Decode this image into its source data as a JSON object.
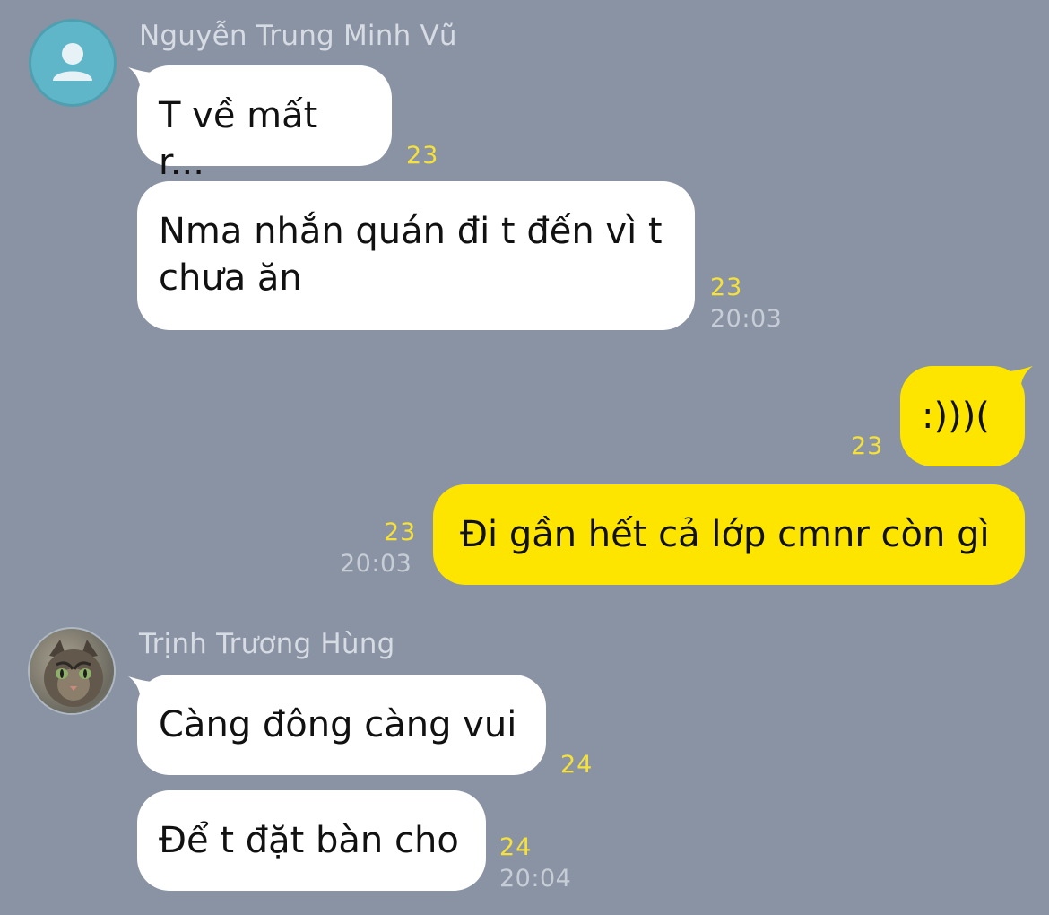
{
  "messages": [
    {
      "sender": "Nguyễn Trung Minh Vũ",
      "text": "T về mất r...",
      "unread": "23",
      "time": ""
    },
    {
      "sender": "",
      "text": "Nma nhắn quán đi t đến vì t chưa ăn",
      "unread": "23",
      "time": "20:03"
    },
    {
      "sender": "me",
      "text": ":)))(",
      "unread": "23",
      "time": ""
    },
    {
      "sender": "me",
      "text": "Đi gần hết cả lớp cmnr còn gì",
      "unread": "23",
      "time": "20:03"
    },
    {
      "sender": "Trịnh Trương Hùng",
      "text": "Càng đông càng vui",
      "unread": "24",
      "time": ""
    },
    {
      "sender": "",
      "text": "Để t đặt bàn cho",
      "unread": "24",
      "time": "20:04"
    }
  ],
  "colors": {
    "background": "#8a93a3",
    "incoming_bubble": "#ffffff",
    "outgoing_bubble": "#fee500",
    "unread_count": "#f5e13a"
  },
  "icons": {
    "default_avatar": "person-silhouette-icon",
    "profile_photo": "cat-photo-avatar"
  }
}
